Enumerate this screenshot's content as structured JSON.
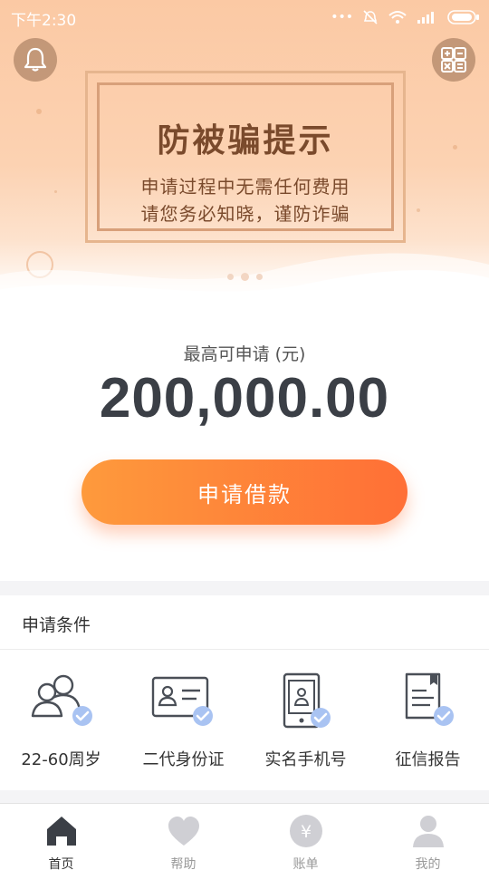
{
  "status_bar": {
    "time": "下午2:30"
  },
  "banner": {
    "notice_title": "防被骗提示",
    "notice_line1": "申请过程中无需任何费用",
    "notice_line2": "请您务必知晓，谨防诈骗",
    "carousel_dots": 3,
    "carousel_active": 1
  },
  "limit": {
    "label": "最高可申请 (元)",
    "amount": "200,000.00"
  },
  "apply_button": {
    "label": "申请借款"
  },
  "conditions": {
    "title": "申请条件",
    "items": [
      {
        "label": "22-60周岁",
        "icon": "users-check-icon"
      },
      {
        "label": "二代身份证",
        "icon": "id-card-check-icon"
      },
      {
        "label": "实名手机号",
        "icon": "phone-check-icon"
      },
      {
        "label": "征信报告",
        "icon": "report-check-icon"
      }
    ]
  },
  "tabbar": {
    "items": [
      {
        "label": "首页",
        "icon": "home-icon",
        "active": true
      },
      {
        "label": "帮助",
        "icon": "heart-icon",
        "active": false
      },
      {
        "label": "账单",
        "icon": "yen-icon",
        "active": false
      },
      {
        "label": "我的",
        "icon": "user-icon",
        "active": false
      }
    ]
  },
  "colors": {
    "accent": "#ff7a38",
    "tab_active": "#3b3f46",
    "tab_inactive": "#cfcfd4",
    "check_badge": "#a9c3f2"
  }
}
